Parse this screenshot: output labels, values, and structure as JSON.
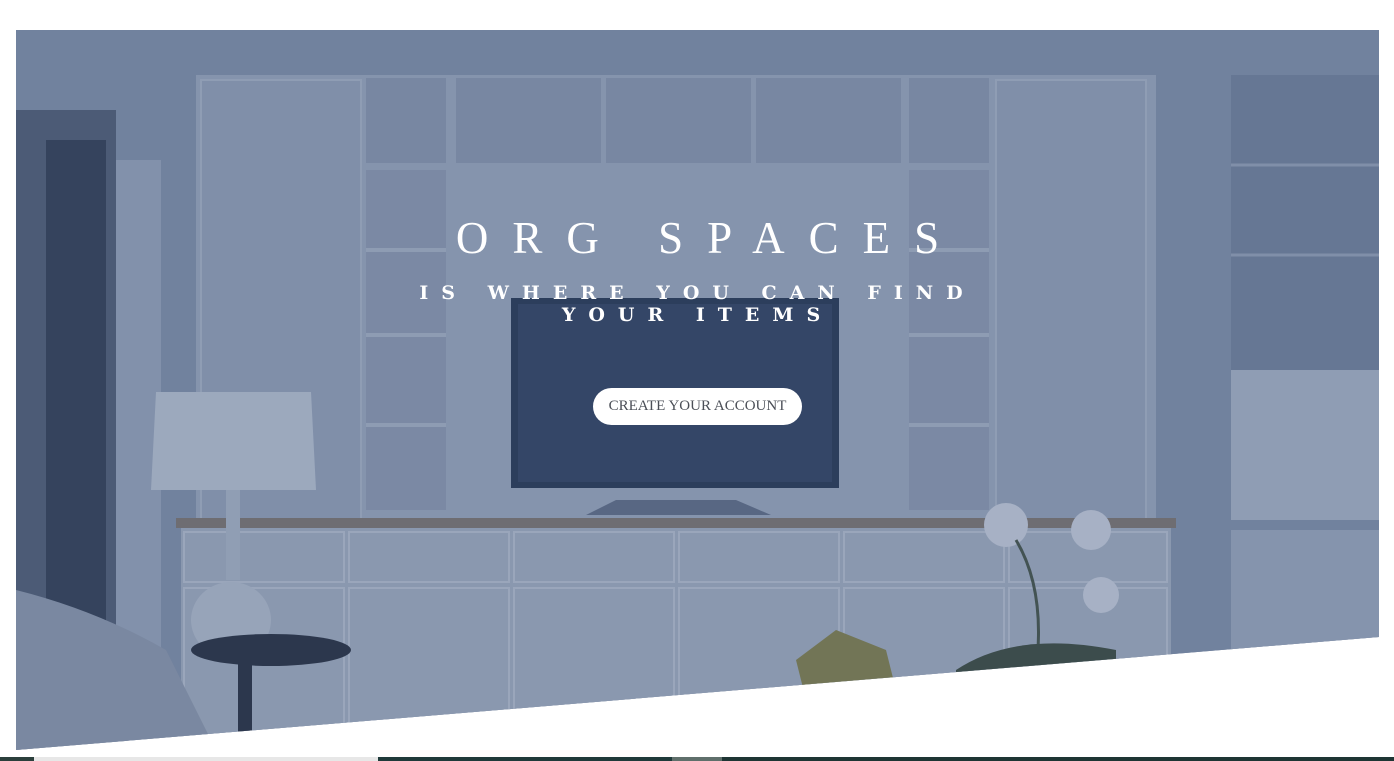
{
  "hero": {
    "title": "ORG SPACES",
    "subtitle": "IS WHERE YOU CAN FIND YOUR ITEMS",
    "cta_label": "CREATE YOUR ACCOUNT"
  },
  "colors": {
    "overlay": "#28406e",
    "button_bg": "#ffffff",
    "button_text": "#4b4f57",
    "title_text": "#ffffff",
    "bottom_strip": "#1f3a3a"
  }
}
